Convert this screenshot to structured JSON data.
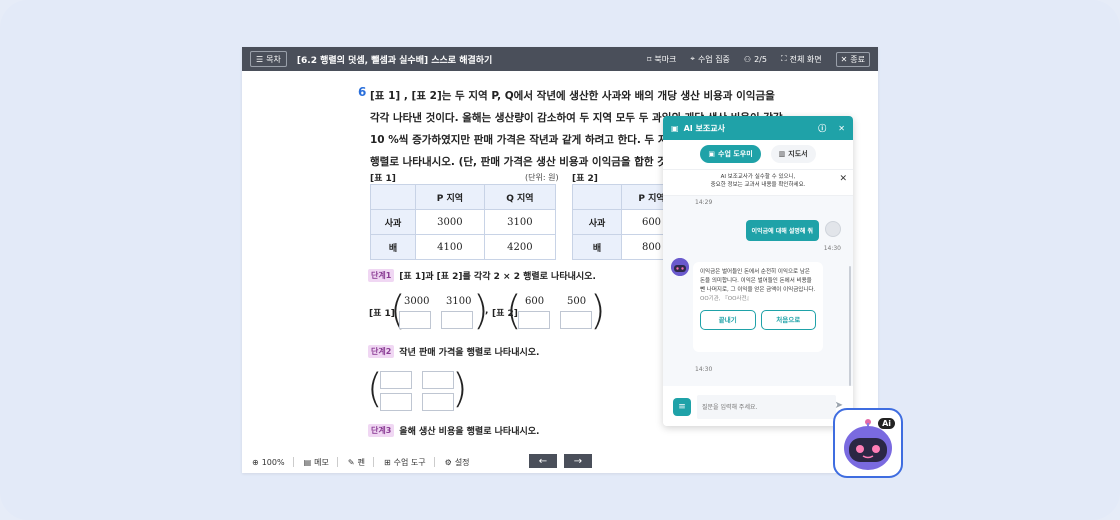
{
  "toolbar": {
    "toc_label": "목차",
    "title": "[6.2 행렬의 덧셈, 뺄셈과 실수배] 스스로 해결하기",
    "bookmark": "북마크",
    "focus_mode": "수업 집중",
    "page_indicator": "2/5",
    "fullscreen": "전체 화면",
    "close": "종료"
  },
  "question": {
    "number": "6",
    "line1": "[표 1] , [표 2]는 두 지역 P, Q에서 작년에 생산한 사과와 배의 개당 생산 비용과 이익금을",
    "line2": "각각 나타낸 것이다. 올해는 생산량이 감소하여 두 지역 모두 두 과일의 개당 생산 비용이 각각",
    "line3": "10 %씩 증가하였지만 판매 가격은 작년과 같게 하려고 한다. 두 지역",
    "line4": "행렬로 나타내시오. (단, 판매 가격은 생산 비용과 이익금을 합한 것으"
  },
  "table1": {
    "label": "[표 1]",
    "unit": "(단위: 원)",
    "headers": [
      "P 지역",
      "Q 지역"
    ],
    "rows": [
      {
        "name": "사과",
        "values": [
          "3000",
          "3100"
        ]
      },
      {
        "name": "배",
        "values": [
          "4100",
          "4200"
        ]
      }
    ]
  },
  "table2": {
    "label": "[표 2]",
    "header": "P 지역",
    "rows": [
      {
        "name": "사과",
        "value": "600"
      },
      {
        "name": "배",
        "value": "800"
      }
    ]
  },
  "steps": [
    {
      "badge": "단계1",
      "text": "[표 1]과 [표 2]를 각각 2 × 2 행렬로 나타내시오."
    },
    {
      "badge": "단계2",
      "text": "작년 판매 가격을 행렬로 나타내시오."
    },
    {
      "badge": "단계3",
      "text": "올해 생산 비용을 행렬로 나타내시오."
    }
  ],
  "matrix1": {
    "label": "[표 1]",
    "top": [
      "3000",
      "3100"
    ]
  },
  "matrix_sep": ",",
  "matrix2": {
    "label": "[표 2]",
    "top": [
      "600",
      "500"
    ]
  },
  "bottombar": {
    "zoom": "100%",
    "memo": "메모",
    "pen": "펜",
    "class_tools": "수업 도구",
    "settings": "설정"
  },
  "ai": {
    "title": "AI 보조교사",
    "tab_active": "수업 도우미",
    "tab_inactive": "지도서",
    "notice_line1": "AI 보조교사가 실수할 수 있으니,",
    "notice_line2": "중요한 정보는 교과서 내용을 확인하세요.",
    "ts1": "14:29",
    "user_message": "이익금에 대해 설명해 줘",
    "ts2": "14:30",
    "bot_message": "이익금은 벌어들인 돈에서 순전히 이익으로 남은 돈을 의미합니다. 이익은 벌어들인 돈에서 비용을 뺀 나머지로, 그 이익을 얻은 금액이 이익금입니다.",
    "bot_source": "OO기관, 『OO사전』",
    "btn_end": "끝내기",
    "btn_restart": "처음으로",
    "ts3": "14:30",
    "input_placeholder": "질문을 입력해 주세요.",
    "fab_badge": "Ai"
  },
  "colors": {
    "accent": "#1fa2a8",
    "toolbar": "#4a4f5a",
    "question_number": "#2a6fdb"
  }
}
